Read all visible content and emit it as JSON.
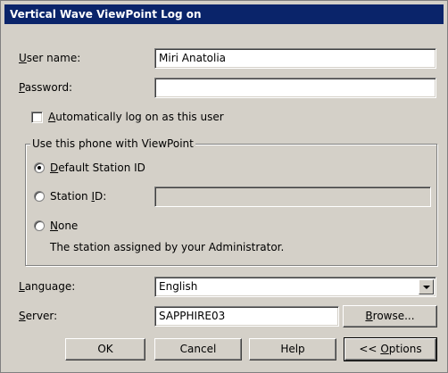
{
  "window": {
    "title": "Vertical Wave ViewPoint Log on"
  },
  "form": {
    "username": {
      "label": "User name:",
      "mnemonic": "U",
      "rest": "ser name:",
      "value": "Miri Anatolia"
    },
    "password": {
      "label": "Password:",
      "mnemonic": "P",
      "rest": "assword:",
      "value": ""
    },
    "auto_logon": {
      "label": "Automatically log on as this user",
      "mnemonic": "A",
      "rest": "utomatically log on as this user",
      "checked": false
    }
  },
  "phone_group": {
    "legend": "Use this phone with ViewPoint",
    "options": [
      {
        "label": "Default Station ID",
        "mnemonic": "D",
        "rest": "efault Station ID",
        "selected": true
      },
      {
        "label": "Station ID:",
        "pre": "Station ",
        "mnemonic": "I",
        "post": "D:",
        "selected": false,
        "value": ""
      },
      {
        "label": "None",
        "mnemonic": "N",
        "rest": "one",
        "selected": false
      }
    ],
    "note": "The station assigned by your Administrator."
  },
  "language": {
    "label": "Language:",
    "mnemonic": "L",
    "rest": "anguage:",
    "selected": "English"
  },
  "server": {
    "label": "Server:",
    "mnemonic": "S",
    "rest": "erver:",
    "value": "SAPPHIRE03",
    "browse_label": "Browse...",
    "browse_mnemonic": "B",
    "browse_rest": "rowse..."
  },
  "buttons": {
    "ok": "OK",
    "cancel": "Cancel",
    "help": "Help",
    "options_pre": "<< ",
    "options_mnemonic": "O",
    "options_rest": "ptions"
  },
  "colors": {
    "titlebar": "#0a246a",
    "face": "#d4d0c8"
  }
}
